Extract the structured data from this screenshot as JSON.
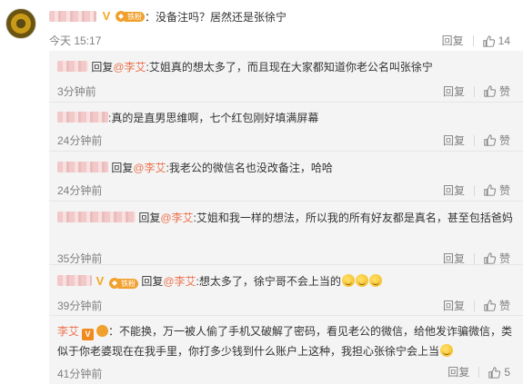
{
  "root": {
    "badge": "铁粉",
    "separator": "：",
    "text": "没备注吗？居然还是张徐宁",
    "time": "今天 15:17",
    "reply_label": "回复",
    "like_count": "14"
  },
  "replies": [
    {
      "prefix": "回复",
      "mention": "@李艾",
      "text": ":艾姐真的想太多了，而且现在大家都知道你老公名叫张徐宁",
      "time": "3分钟前",
      "reply_label": "回复",
      "like_label": "赞"
    },
    {
      "prefix": "",
      "mention": "",
      "text": ":真的是直男思维啊，七个红包刚好填满屏幕",
      "time": "24分钟前",
      "reply_label": "回复",
      "like_label": "赞"
    },
    {
      "prefix": "回复",
      "mention": "@李艾",
      "text": ":我老公的微信名也没改备注，哈哈",
      "time": "24分钟前",
      "reply_label": "回复",
      "like_label": "赞"
    },
    {
      "prefix": "回复",
      "mention": "@李艾",
      "text": ":艾姐和我一样的想法，所以我的所有好友都是真名，甚至包括爸妈",
      "time": "35分钟前",
      "reply_label": "回复",
      "like_label": "赞"
    },
    {
      "badge": "铁粉",
      "prefix": "回复",
      "mention": "@李艾",
      "text": ":想太多了，徐宁哥不会上当的",
      "time": "39分钟前",
      "reply_label": "回复",
      "like_label": "赞"
    },
    {
      "author": "李艾",
      "text": "：不能换，万一被人偷了手机又破解了密码，看见老公的微信，给他发诈骗微信，类似于你老婆现在在我手里，你打多少钱到什么账户上这种，我担心张徐宁会上当",
      "time": "41分钟前",
      "reply_label": "回复",
      "like_count": "5"
    }
  ]
}
